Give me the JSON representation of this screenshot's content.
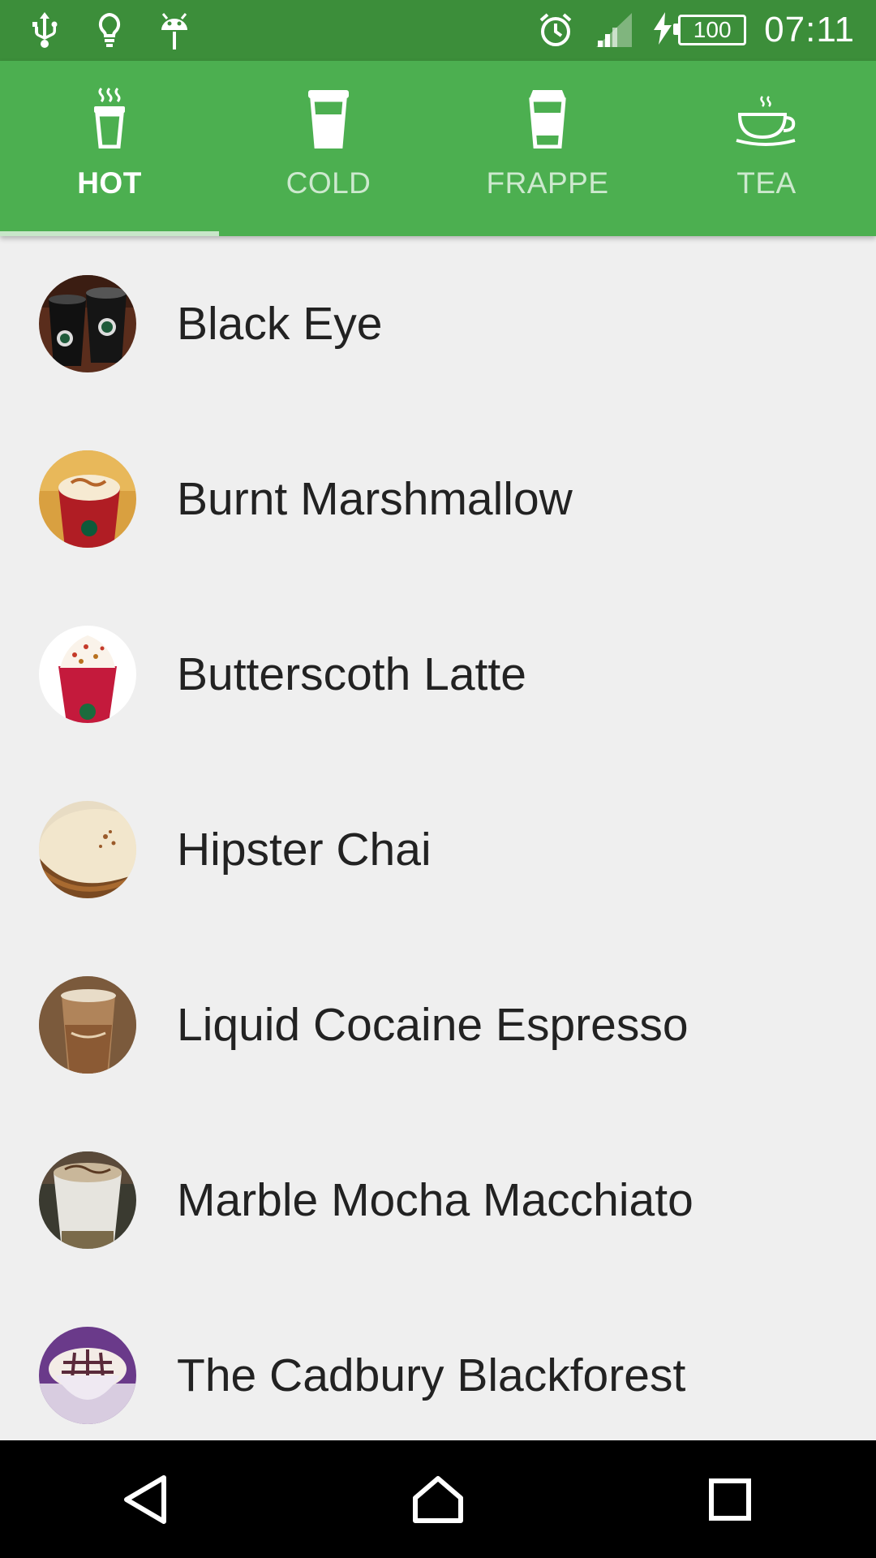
{
  "status_bar": {
    "time": "07:11",
    "battery_level": "100",
    "icons": [
      "usb-icon",
      "lightbulb-icon",
      "android-icon",
      "alarm-icon",
      "signal-icon",
      "charging-icon",
      "battery-icon"
    ]
  },
  "tabs": [
    {
      "label": "HOT",
      "icon": "hot-cup-icon",
      "active": true
    },
    {
      "label": "COLD",
      "icon": "cold-cup-icon",
      "active": false
    },
    {
      "label": "FRAPPE",
      "icon": "frappe-cup-icon",
      "active": false
    },
    {
      "label": "TEA",
      "icon": "tea-cup-icon",
      "active": false
    }
  ],
  "drinks": [
    {
      "name": "Black Eye",
      "thumb": "black-eye-thumbnail"
    },
    {
      "name": "Burnt Marshmallow",
      "thumb": "burnt-marshmallow-thumbnail"
    },
    {
      "name": "Butterscoth Latte",
      "thumb": "butterscoth-latte-thumbnail"
    },
    {
      "name": "Hipster Chai",
      "thumb": "hipster-chai-thumbnail"
    },
    {
      "name": "Liquid Cocaine Espresso",
      "thumb": "liquid-cocaine-espresso-thumbnail"
    },
    {
      "name": "Marble Mocha Macchiato",
      "thumb": "marble-mocha-macchiato-thumbnail"
    },
    {
      "name": "The Cadbury Blackforest",
      "thumb": "cadbury-blackforest-thumbnail"
    }
  ],
  "colors": {
    "status_bar": "#3c8e3a",
    "tab_bar": "#4caf50",
    "tab_indicator": "#c8e6c9",
    "background": "#efefef",
    "text": "#222222"
  },
  "nav": {
    "back": "back-icon",
    "home": "home-icon",
    "recents": "recents-icon"
  }
}
